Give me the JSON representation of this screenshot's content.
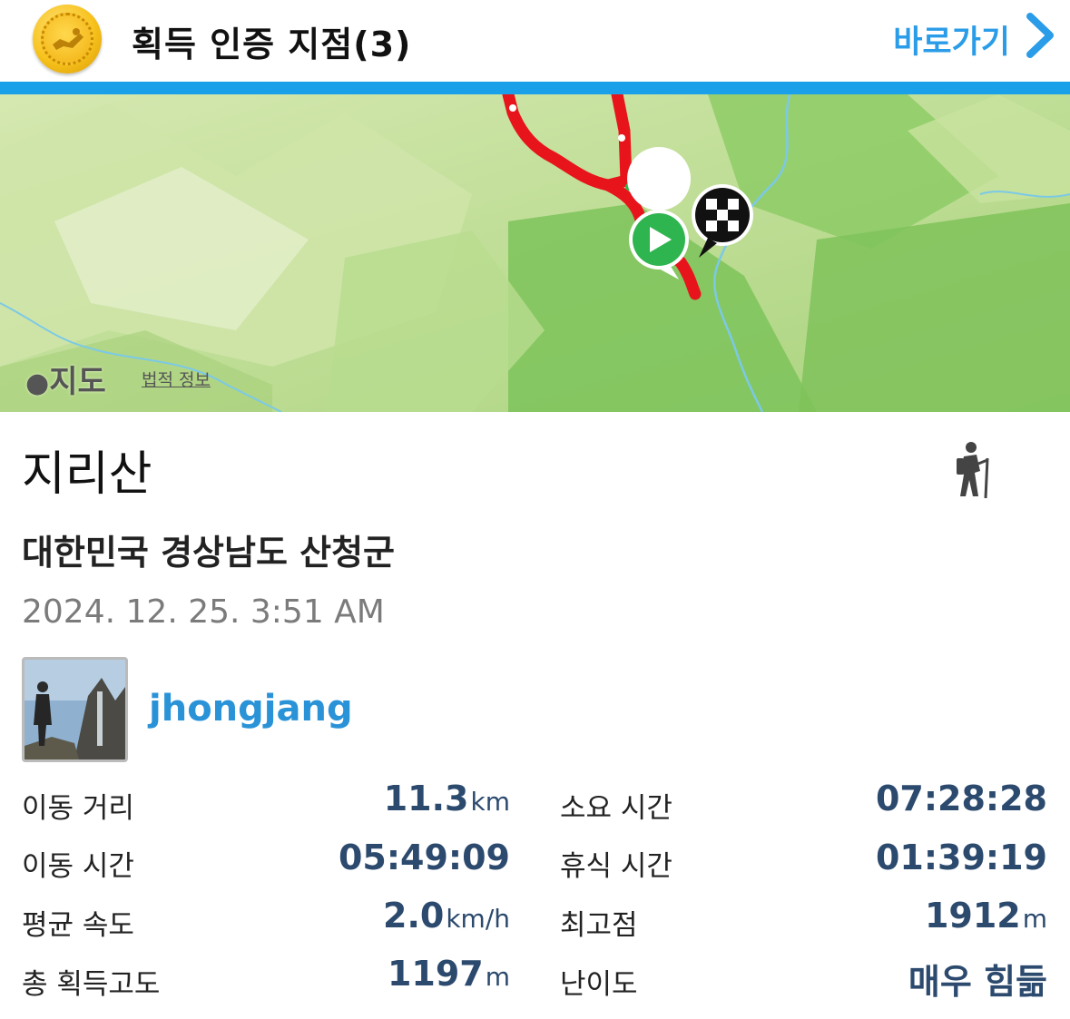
{
  "header": {
    "title": "획득 인증 지점(3)",
    "goto_label": "바로가기",
    "accent_color": "#1aa0e8"
  },
  "map": {
    "provider_label": "지도",
    "legal_label": "법적 정보",
    "route_color": "#e8141c"
  },
  "activity": {
    "peak_name": "지리산",
    "location": "대한민국 경상남도 산청군",
    "datetime": "2024. 12. 25. 3:51 AM",
    "username": "jhongjang",
    "activity_icon": "hiker-icon"
  },
  "stats": {
    "distance": {
      "label": "이동 거리",
      "value": "11.3",
      "unit": "km"
    },
    "total_time": {
      "label": "소요 시간",
      "value": "07:28:28",
      "unit": ""
    },
    "moving_time": {
      "label": "이동 시간",
      "value": "05:49:09",
      "unit": ""
    },
    "rest_time": {
      "label": "휴식 시간",
      "value": "01:39:19",
      "unit": ""
    },
    "avg_speed": {
      "label": "평균 속도",
      "value": "2.0",
      "unit": "km/h"
    },
    "max_elevation": {
      "label": "최고점",
      "value": "1912",
      "unit": "m"
    },
    "elevation_gain": {
      "label": "총 획득고도",
      "value": "1197",
      "unit": "m"
    },
    "difficulty": {
      "label": "난이도",
      "value": "매우 힘듦",
      "unit": ""
    }
  }
}
